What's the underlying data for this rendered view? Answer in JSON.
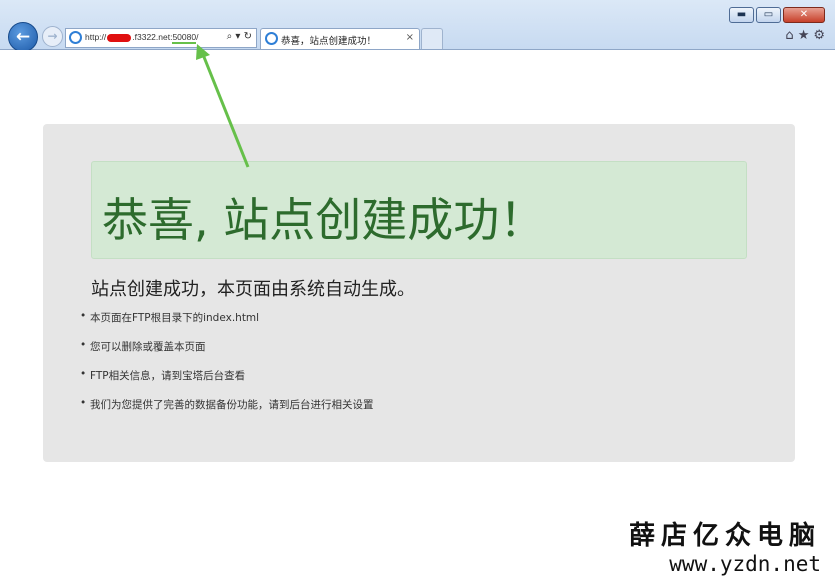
{
  "browser": {
    "address": {
      "prefix": "http://",
      "domain": ".f3322.net:",
      "port": "50080",
      "suffix": "/",
      "tools": "⌕ ▾ ↻"
    },
    "tab": {
      "title": "恭喜，站点创建成功！",
      "close_glyph": "×"
    },
    "window_controls": {
      "minimize": "▬",
      "maximize": "▭",
      "close": "✕"
    },
    "toolbar_icons": {
      "home": "⌂",
      "favorites": "★",
      "settings": "⚙"
    },
    "nav": {
      "back_glyph": "←",
      "forward_glyph": "→"
    },
    "accent_color": "#66c04a"
  },
  "page": {
    "banner_title": "恭喜, 站点创建成功！",
    "subtitle": "站点创建成功，本页面由系统自动生成。",
    "bullets": [
      "本页面在FTP根目录下的index.html",
      "您可以删除或覆盖本页面",
      "FTP相关信息，请到宝塔后台查看",
      "我们为您提供了完善的数据备份功能，请到后台进行相关设置"
    ]
  },
  "watermark": {
    "name": "薛店亿众电脑",
    "url": "www.yzdn.net"
  }
}
